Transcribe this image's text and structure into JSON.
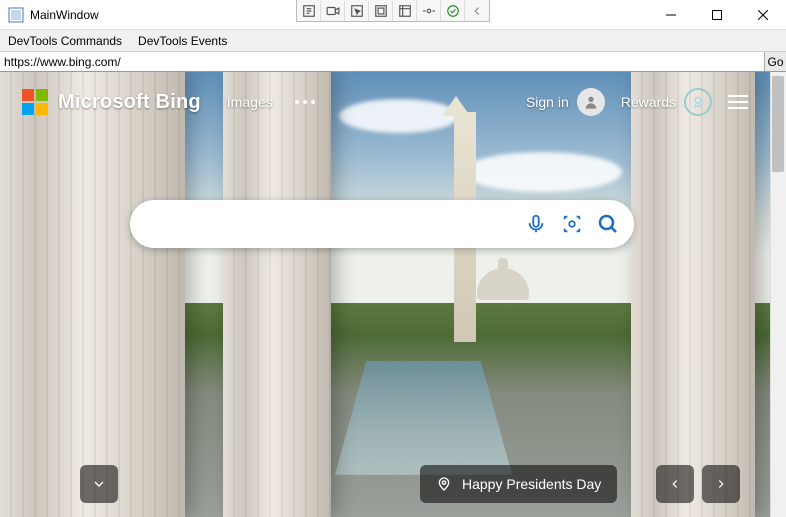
{
  "window": {
    "title": "MainWindow",
    "tools": [
      "settings",
      "record",
      "cursor",
      "frame",
      "screenshot",
      "target",
      "check",
      "back"
    ]
  },
  "menubar": {
    "items": [
      "DevTools Commands",
      "DevTools Events"
    ]
  },
  "url": {
    "value": "https://www.bing.com/",
    "go_label": "Go"
  },
  "bing": {
    "brand": "Microsoft Bing",
    "nav_images": "Images",
    "sign_in": "Sign in",
    "rewards": "Rewards",
    "search_placeholder": "",
    "caption": "Happy Presidents Day"
  }
}
